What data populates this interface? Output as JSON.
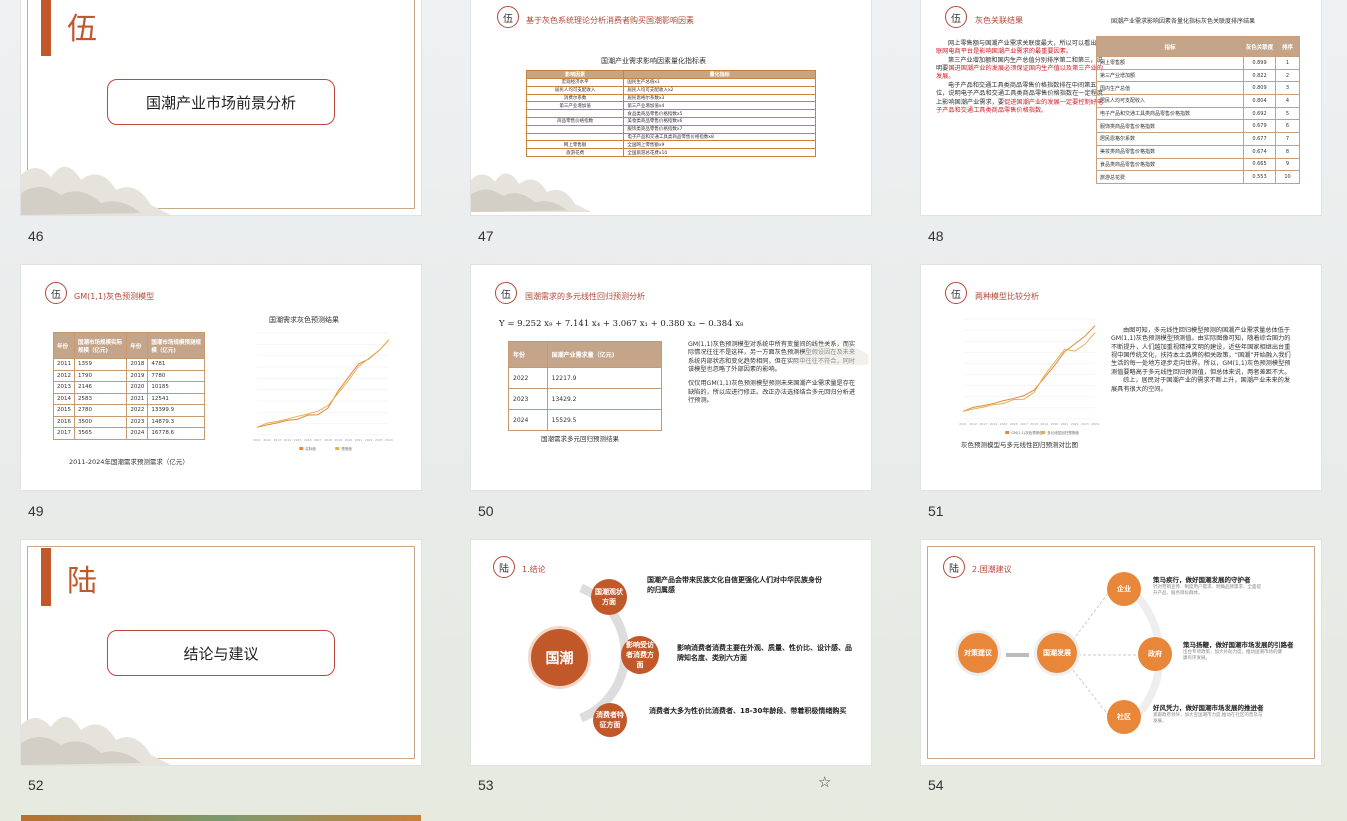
{
  "slides": {
    "s46": {
      "number": "46",
      "section_char": "伍",
      "section_title": "国潮产业市场前景分析"
    },
    "s47": {
      "number": "47",
      "circle": "伍",
      "title": "基于灰色系统理论分析消费者购买国潮影响因素",
      "table_title": "国潮产业需求影响因素量化指标表",
      "headers": [
        "影响因素",
        "量化指标"
      ],
      "rows": [
        [
          "宏观经济水平",
          "国民生产总值x1"
        ],
        [
          "居民人均可支配收入",
          "居民人均可支配收入x2"
        ],
        [
          "消费尔系数",
          "居民恩格尔系数x3"
        ],
        [
          "第三产业增加值",
          "第三产业增加值x4"
        ],
        [
          "",
          "食品类商品零售价格指数x5"
        ],
        [
          "商品零售价格指数",
          "美妆类商品零售价格指数x6"
        ],
        [
          "",
          "服饰类商品零售价格指数x7"
        ],
        [
          "",
          "电子产品和交通工具类商品零售价格指数x8"
        ],
        [
          "网上零售额",
          "全国网上零售额x9"
        ],
        [
          "旅游花费",
          "全国旅游总花费x10"
        ]
      ]
    },
    "s48": {
      "number": "48",
      "circle": "伍",
      "title": "灰色关联结果",
      "p1a": "网上零售额与国潮产业需求关联度最大，所以可以看出",
      "p1b": "互联网电商平台是影响国潮产业需求的最重要因素。",
      "p2a": "第三产业增加额和国内生产总值分别排序第二和第三，说明要",
      "p2b": "国进国潮产业的发展必须保证国内生产值以及第三产业的发展。",
      "p3a": "电子产品和交通工具类商品零售价格指数排在中间第五位，说明电子产品和交通工具类商品零售价格指数在一定程度上影响国潮产业需求，要",
      "p3b": "促进国潮产业的发展一定要控制好电子产品和交通工具类商品零售价格指数。",
      "table_title": "国潮产业需求影响因素各量化指标灰色关联度排序结果",
      "headers": [
        "指标",
        "灰色关联度",
        "排序"
      ],
      "rows": [
        [
          "网上零售额",
          "0.899",
          "1"
        ],
        [
          "第三产业增加额",
          "0.822",
          "2"
        ],
        [
          "国内生产总值",
          "0.809",
          "3"
        ],
        [
          "居民人均可支配收入",
          "0.804",
          "4"
        ],
        [
          "电子产品和交通工具类商品零售价格指数",
          "0.692",
          "5"
        ],
        [
          "服饰类商品零售价格指数",
          "0.679",
          "6"
        ],
        [
          "居民恩格尔系数",
          "0.677",
          "7"
        ],
        [
          "美妆类商品零售价格指数",
          "0.674",
          "8"
        ],
        [
          "食品类商品零售价格指数",
          "0.665",
          "9"
        ],
        [
          "旅游总花费",
          "0.553",
          "10"
        ]
      ]
    },
    "s49": {
      "number": "49",
      "circle": "伍",
      "title": "GM(1,1)灰色预测模型",
      "headers": [
        "年份",
        "国潮市场规模实际规模（亿元)",
        "年份",
        "国潮市场规模预测规模（亿元)"
      ],
      "rows": [
        [
          "2011",
          "1359",
          "2018",
          "4781"
        ],
        [
          "2012",
          "1790",
          "2019",
          "7780"
        ],
        [
          "2013",
          "2146",
          "2020",
          "10185"
        ],
        [
          "2014",
          "2583",
          "2021",
          "12541"
        ],
        [
          "2015",
          "2780",
          "2022",
          "13399.9"
        ],
        [
          "2016",
          "3500",
          "2023",
          "14879.3"
        ],
        [
          "2017",
          "3565",
          "2024",
          "16778.6"
        ]
      ],
      "caption": "2011-2024年国潮需求预测需求（亿元）",
      "chart_title": "国潮需求灰色预测结果",
      "legend": [
        "实际值",
        "预测值"
      ]
    },
    "s50": {
      "number": "50",
      "circle": "伍",
      "title": "国潮需求的多元线性回归预测分析",
      "equation": "Y = 9.252 x₉ + 7.141 x₄ + 3.067 x₁ + 0.380 x₂ − 0.384 x₈",
      "headers": [
        "年份",
        "国潮产业需求量（亿元)"
      ],
      "rows": [
        [
          "2022",
          "12217.9"
        ],
        [
          "2023",
          "13429.2"
        ],
        [
          "2024",
          "15529.5"
        ]
      ],
      "caption": "国潮需求多元回归预测结果",
      "p1": "GM(1,1)灰色预测模型对系统中所有变量间的线性关系，而实际情况往往不是这样，另一方面灰色预测模型假设因在及未来系统内部状态和变化趋势相同，但在实际中往往不符合，同时该模型也忽略了外部因素的影响。",
      "p2": "仅仅用GM(1,1)灰色预测模型预测未来国潮产业需求量是存在缺陷的，所以应进行修正。改正办法选择结合多元回归分析进行预测。"
    },
    "s51": {
      "number": "51",
      "circle": "伍",
      "title": "两种模型比较分析",
      "chart_caption": "灰色预测模型与多元线性回归预测对比图",
      "p1": "由图可知，多元线性回归模型预测的国潮产业需求量总体低于GM(1,1)灰色预测模型预测值。由实际图像可知，随着综合国力的不断提升，人们越加重视精神文明的建设，近些年国家相继出台重视中国传统文化，扶持本土品牌的相关政策，“国潮”开始融入我们生活的每一处地方逐步走向世界。所以，GM(1,1)灰色预测模型预测值要略高于多元线性回归预测值，但总体来说，两者差距不大。",
      "p2": "综上，居民对于国潮产业的需求不断上升，国潮产业未来的发展具有很大的空间。",
      "legend": [
        "GM(1,1)灰色预测值",
        "多元线性回归预测值"
      ]
    },
    "s52": {
      "number": "52",
      "section_char": "陆",
      "section_title": "结论与建议"
    },
    "s53": {
      "number": "53",
      "circle": "陆",
      "title": "1.结论",
      "center": "国潮",
      "nodes": [
        "国潮观状方面",
        "影响受访者消费方面",
        "消费者特征方面"
      ],
      "texts": [
        "国潮产品会带来民族文化自信更强化人们对中华民族身份的归属感",
        "影响消费者消费主要在外观、质量、性价比、设计感、品牌知名度、类别六方面",
        "消费者大多为性价比消费者、18-30年龄段、带着积极情绪购买"
      ]
    },
    "s54": {
      "number": "54",
      "circle": "陆",
      "title": "2.国潮建议",
      "left": "对策建议",
      "mid": "国潮发展",
      "nodes": [
        "企业",
        "政府",
        "社区"
      ],
      "heads": [
        "策马疾行，做好国潮发展的守护者",
        "策马扬鞭，做好国潮市场发展的引路者",
        "好风凭力，做好国潮市场发展的推进者"
      ],
      "subs": [
        "针对营销宣传、制度用户需求、明确品牌需求、全面提升产品、服务目标群体。",
        "出台专项政策，加大补助力度，推动国潮市场的健康有序发展。",
        "紧跟政府领导，加大宣国潮市力度,推动在社区的普及与发展。"
      ]
    }
  },
  "chart_data": [
    {
      "type": "line",
      "title": "国潮需求灰色预测结果",
      "x": [
        "2011",
        "2012",
        "2013",
        "2014",
        "2015",
        "2016",
        "2017",
        "2018",
        "2019",
        "2020",
        "2021",
        "2022",
        "2023",
        "2024"
      ],
      "series": [
        {
          "name": "实际值",
          "values": [
            1359,
            1790,
            2146,
            2583,
            2780,
            3500,
            3565,
            4781,
            7780,
            10185,
            12541,
            13399.9,
            14879.3,
            16778.6
          ]
        },
        {
          "name": "预测值",
          "values": [
            1359,
            2100,
            2400,
            2800,
            3300,
            3700,
            4200,
            5200,
            7400,
            9600,
            12100,
            13500,
            14900,
            16800
          ]
        }
      ],
      "ylim": [
        0,
        18000
      ]
    },
    {
      "type": "line",
      "x": [
        "2011",
        "2012",
        "2013",
        "2014",
        "2015",
        "2016",
        "2017",
        "2018",
        "2019",
        "2020",
        "2021",
        "2022",
        "2023",
        "2024"
      ],
      "series": [
        {
          "name": "GM(1,1)灰色预测值",
          "values": [
            1359,
            2100,
            2400,
            2800,
            3300,
            3700,
            4200,
            5200,
            7400,
            9600,
            12100,
            13500,
            14900,
            16800
          ]
        },
        {
          "name": "多元线性回归预测值",
          "values": [
            1359,
            1790,
            2146,
            2583,
            2780,
            3500,
            3565,
            4781,
            7780,
            10185,
            12541,
            12217.9,
            13429.2,
            15529.5
          ]
        }
      ],
      "ylim": [
        0,
        18000
      ]
    }
  ],
  "colors": {
    "accent": "#c0582a",
    "red": "#b5473a",
    "orange": "#e8863a",
    "line_orange": "#e8863a",
    "line_gold": "#e0b050"
  }
}
